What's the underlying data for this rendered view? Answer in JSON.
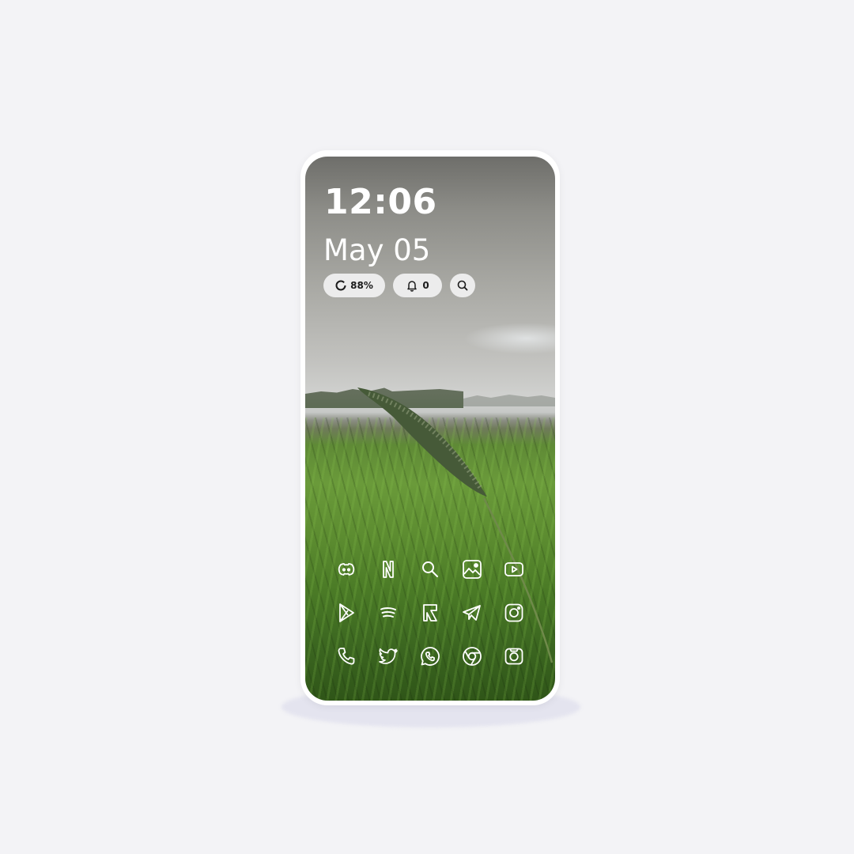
{
  "lockscreen": {
    "time": "12:06",
    "date": "May 05",
    "battery_label": "88%",
    "notifications_label": "0"
  },
  "status_icons": [
    "battery-ring-icon",
    "bell-icon",
    "search-icon"
  ],
  "app_grid": {
    "rows": [
      [
        "discord-icon",
        "netflix-icon",
        "search-app-icon",
        "gallery-icon",
        "youtube-icon"
      ],
      [
        "play-store-icon",
        "spotify-icon",
        "reddit-icon",
        "telegram-icon",
        "instagram-icon"
      ],
      [
        "phone-icon",
        "twitter-icon",
        "whatsapp-icon",
        "chrome-icon",
        "camera-icon"
      ]
    ]
  },
  "colors": {
    "background": "#f3f3f6",
    "chip": "#ececec",
    "icon_stroke": "#ffffff"
  }
}
